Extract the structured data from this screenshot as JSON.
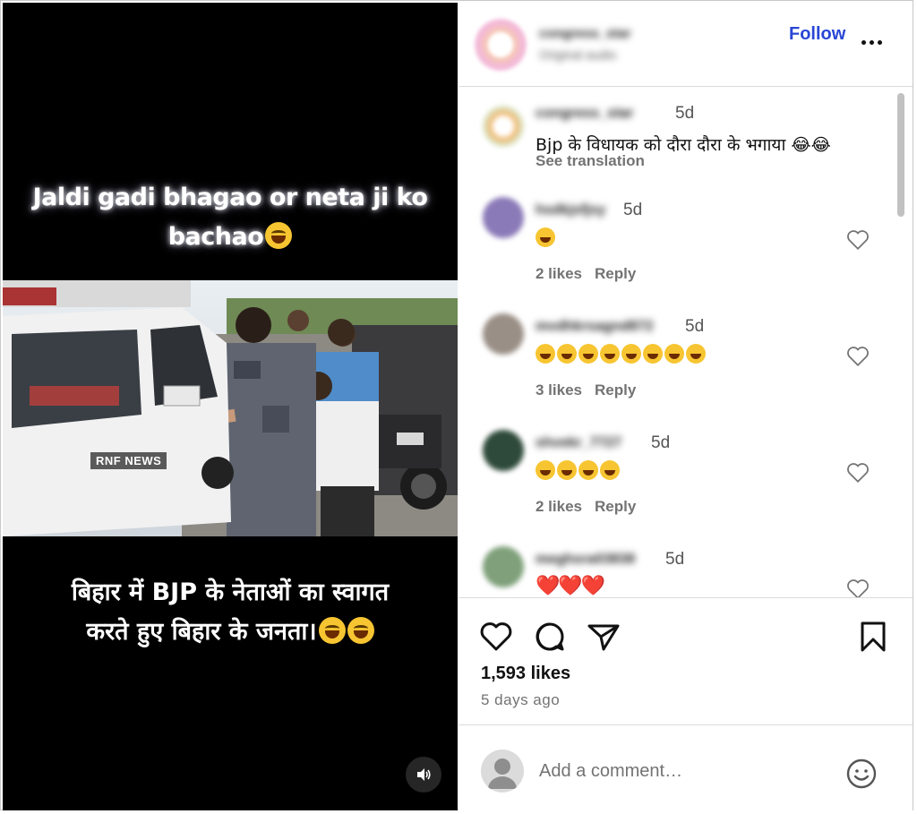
{
  "video": {
    "caption_top_line1": "Jaldi gadi bhagao or neta ji ko",
    "caption_top_line2": "bachao",
    "watermark": "RNF NEWS",
    "caption_bottom_line1": "बिहार में BJP के नेताओं का स्वागत",
    "caption_bottom_line2": "करते हुए बिहार के जनता।"
  },
  "header": {
    "username": "congress_star",
    "subtitle": "Original audio",
    "follow_label": "Follow"
  },
  "comments": [
    {
      "user": "congress_star",
      "time": "5d",
      "text": "Bjp के विधायक को दौरा दौरा के भगाया 😂😂",
      "see_translation": "See translation",
      "avatar_color": "#d7e9cf"
    },
    {
      "user": "hsdkjsfjsy",
      "time": "5d",
      "text": "😂",
      "likes": "2 likes",
      "reply": "Reply",
      "avatar_color": "#8b7ab8"
    },
    {
      "user": "mvdhkrsagnd872",
      "time": "5d",
      "text": "😂😂😂😂😂😂😂😂",
      "likes": "3 likes",
      "reply": "Reply",
      "avatar_color": "#9a8f86"
    },
    {
      "user": "shvekr_7727",
      "time": "5d",
      "text": "😂😂😂😂",
      "likes": "2 likes",
      "reply": "Reply",
      "avatar_color": "#2e4a3a"
    },
    {
      "user": "meghsra03838",
      "time": "5d",
      "text": "❤️❤️❤️",
      "avatar_color": "#7fa07a"
    }
  ],
  "actions": {
    "likes": "1,593 likes",
    "time_ago": "5 days ago"
  },
  "add_comment": {
    "placeholder": "Add a comment…"
  },
  "colors": {
    "follow_blue": "#2846d6",
    "secondary_text": "#737373",
    "video_bg": "#000000"
  }
}
